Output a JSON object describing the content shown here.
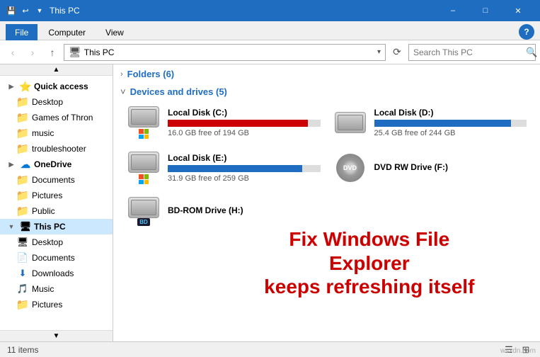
{
  "titleBar": {
    "title": "This PC",
    "controls": {
      "minimize": "–",
      "maximize": "□",
      "close": "✕"
    }
  },
  "ribbon": {
    "tabs": [
      "File",
      "Computer",
      "View"
    ],
    "activeTab": "File",
    "helpBtn": "?"
  },
  "addressBar": {
    "back": "‹",
    "forward": "›",
    "up": "↑",
    "pathIcon": "🖥",
    "pathText": "This PC",
    "refresh": "⟳",
    "searchPlaceholder": "Search This PC",
    "searchIcon": "🔍"
  },
  "sidebar": {
    "scrollUp": "▲",
    "scrollDown": "▼",
    "items": [
      {
        "label": "Quick access",
        "icon": "star",
        "type": "header"
      },
      {
        "label": "Desktop",
        "icon": "folder",
        "indent": 1
      },
      {
        "label": "Games of Thron",
        "icon": "folder",
        "indent": 1
      },
      {
        "label": "music",
        "icon": "folder",
        "indent": 1
      },
      {
        "label": "troubleshooter",
        "icon": "folder",
        "indent": 1
      },
      {
        "label": "OneDrive",
        "icon": "cloud",
        "type": "header"
      },
      {
        "label": "Documents",
        "icon": "folder",
        "indent": 1
      },
      {
        "label": "Pictures",
        "icon": "folder",
        "indent": 1
      },
      {
        "label": "Public",
        "icon": "folder",
        "indent": 1
      },
      {
        "label": "This PC",
        "icon": "pc",
        "type": "selected-header"
      },
      {
        "label": "Desktop",
        "icon": "desktop",
        "indent": 1
      },
      {
        "label": "Documents",
        "icon": "docs",
        "indent": 1
      },
      {
        "label": "Downloads",
        "icon": "download",
        "indent": 1
      },
      {
        "label": "Music",
        "icon": "music",
        "indent": 1
      },
      {
        "label": "Pictures",
        "icon": "folder",
        "indent": 1
      }
    ]
  },
  "content": {
    "sections": [
      {
        "id": "folders",
        "chevron": "›",
        "title": "Folders (6)",
        "expanded": false
      },
      {
        "id": "devices",
        "chevron": "˅",
        "title": "Devices and drives (5)",
        "expanded": true
      }
    ],
    "drives": [
      {
        "id": "c",
        "name": "Local Disk (C:)",
        "iconType": "hdd-windows",
        "usedPct": 92,
        "barColor": "#cc0000",
        "freeSpace": "16.0 GB free of 194 GB"
      },
      {
        "id": "d",
        "name": "Local Disk (D:)",
        "iconType": "hdd",
        "usedPct": 90,
        "barColor": "#1e6dc0",
        "freeSpace": "25.4 GB free of 244 GB"
      },
      {
        "id": "e",
        "name": "Local Disk (E:)",
        "iconType": "hdd-windows",
        "usedPct": 88,
        "barColor": "#1e6dc0",
        "freeSpace": "31.9 GB free of 259 GB"
      },
      {
        "id": "f",
        "name": "DVD RW Drive (F:)",
        "iconType": "dvd",
        "usedPct": 0,
        "barColor": "#1e6dc0",
        "freeSpace": ""
      },
      {
        "id": "h",
        "name": "BD-ROM Drive (H:)",
        "iconType": "bd",
        "usedPct": 0,
        "barColor": "#1e6dc0",
        "freeSpace": ""
      }
    ],
    "overlay": {
      "line1": "Fix Windows File Explorer",
      "line2": "keeps refreshing itself"
    }
  },
  "statusBar": {
    "itemCount": "11 items",
    "watermark": "wsxdn.com"
  }
}
